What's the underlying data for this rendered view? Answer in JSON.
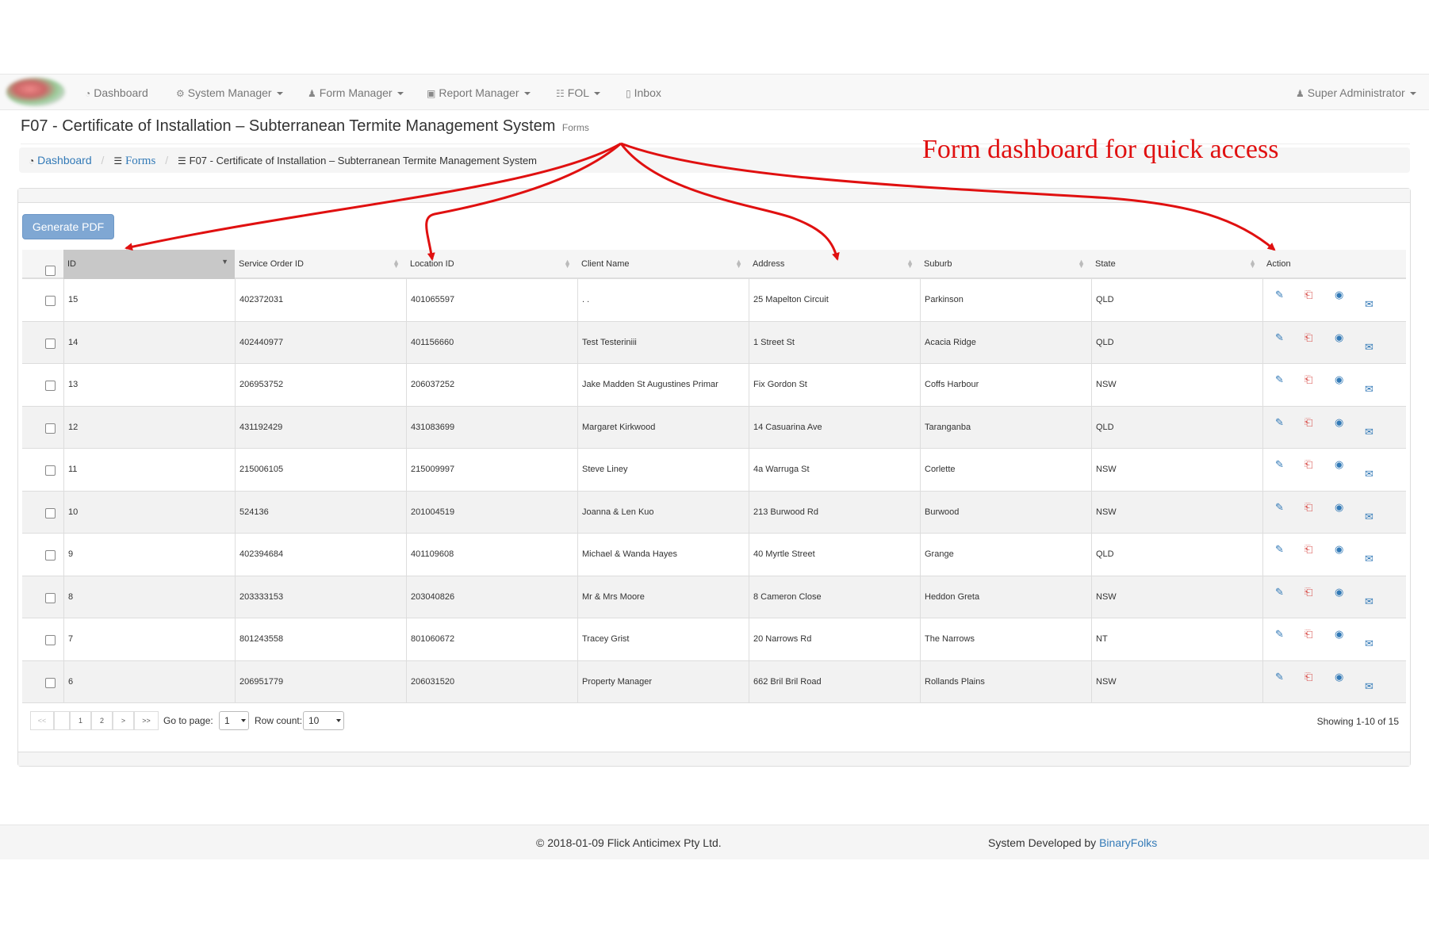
{
  "navbar": {
    "items": [
      {
        "label": "Dashboard",
        "icon": "dashboard-icon"
      },
      {
        "label": "System Manager",
        "icon": "gear-icon"
      },
      {
        "label": "Form Manager",
        "icon": "user-icon"
      },
      {
        "label": "Report Manager",
        "icon": "briefcase-icon"
      },
      {
        "label": "FOL",
        "icon": "sitemap-icon"
      },
      {
        "label": "Inbox",
        "icon": "inbox-icon"
      }
    ],
    "user": "Super Administrator"
  },
  "header": {
    "title": "F07 - Certificate of Installation – Subterranean Termite Management System",
    "subtitle": "Forms"
  },
  "breadcrumb": {
    "home": "Dashboard",
    "forms": "Forms",
    "current": "F07 - Certificate of Installation – Subterranean Termite Management System"
  },
  "annotation": "Form dashboard for quick access",
  "toolbar": {
    "generate_pdf": "Generate PDF"
  },
  "table": {
    "columns": [
      "ID",
      "Service Order ID",
      "Location ID",
      "Client Name",
      "Address",
      "Suburb",
      "State",
      "Action"
    ],
    "rows": [
      [
        "15",
        "402372031",
        "401065597",
        ". .",
        "25 Mapelton Circuit",
        "Parkinson",
        "QLD"
      ],
      [
        "14",
        "402440977",
        "401156660",
        "Test Testeriniii",
        "1 Street St",
        "Acacia Ridge",
        "QLD"
      ],
      [
        "13",
        "206953752",
        "206037252",
        "Jake Madden St Augustines Primar",
        "Fix Gordon St",
        "Coffs Harbour",
        "NSW"
      ],
      [
        "12",
        "431192429",
        "431083699",
        "Margaret Kirkwood",
        "14 Casuarina Ave",
        "Taranganba",
        "QLD"
      ],
      [
        "11",
        "215006105",
        "215009997",
        "Steve Liney",
        "4a Warruga St",
        "Corlette",
        "NSW"
      ],
      [
        "10",
        "524136",
        "201004519",
        "Joanna & Len Kuo",
        "213 Burwood Rd",
        "Burwood",
        "NSW"
      ],
      [
        "9",
        "402394684",
        "401109608",
        "Michael & Wanda Hayes",
        "40 Myrtle Street",
        "Grange",
        "QLD"
      ],
      [
        "8",
        "203333153",
        "203040826",
        "Mr & Mrs Moore",
        "8 Cameron Close",
        "Heddon Greta",
        "NSW"
      ],
      [
        "7",
        "801243558",
        "801060672",
        "Tracey Grist",
        "20 Narrows Rd",
        "The Narrows",
        "NT"
      ],
      [
        "6",
        "206951779",
        "206031520",
        "Property Manager",
        "662 Bril Bril Road",
        "Rollands Plains",
        "NSW"
      ]
    ]
  },
  "pagination": {
    "first": "<<",
    "prev": "",
    "pages": [
      "1",
      "2"
    ],
    "next": ">",
    "last": ">>",
    "goto_label": "Go to page:",
    "goto_value": "1",
    "rowcount_label": "Row count:",
    "rowcount_value": "10",
    "showing": "Showing 1-10 of 15"
  },
  "footer": {
    "copyright": "© 2018-01-09 Flick Anticimex Pty Ltd.",
    "developed_by": "System Developed by ",
    "developer": "BinaryFolks"
  },
  "colors": {
    "accent": "#337ab7",
    "annotation": "#e01010",
    "pdf": "#d9534f"
  }
}
